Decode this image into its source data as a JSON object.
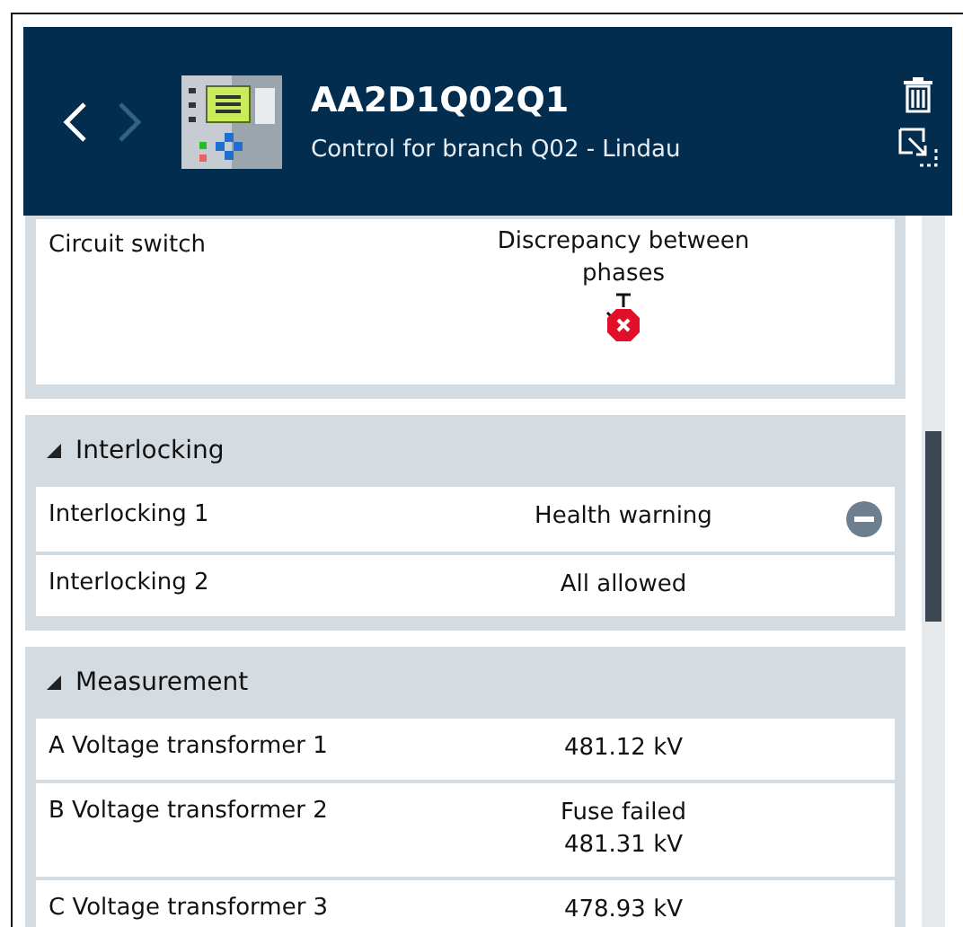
{
  "header": {
    "title": "AA2D1Q02Q1",
    "subtitle": "Control for branch Q02 - Lindau",
    "back": {
      "disabled": false
    },
    "forward": {
      "disabled": true
    }
  },
  "sections": [
    {
      "rows": [
        {
          "label": "Circuit switch",
          "value": "Discrepancy between phases",
          "kind": "switch-error"
        }
      ]
    },
    {
      "title": "Interlocking",
      "expanded": true,
      "rows": [
        {
          "label": "Interlocking 1",
          "value": "Health warning",
          "kind": "warning"
        },
        {
          "label": "Interlocking 2",
          "value": "All allowed"
        }
      ]
    },
    {
      "title": "Measurement",
      "expanded": true,
      "rows": [
        {
          "label": "A Voltage transformer 1",
          "value": "481.12 kV"
        },
        {
          "label": "B Voltage transformer 2",
          "value": "Fuse failed",
          "value_2": "481.31 kV"
        },
        {
          "label": "C Voltage transformer 3",
          "value": "478.93 kV"
        }
      ]
    }
  ]
}
